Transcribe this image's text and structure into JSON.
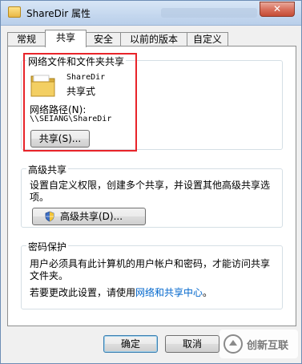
{
  "window": {
    "title": "ShareDir 属性",
    "close_glyph": "✕"
  },
  "tabs": [
    "常规",
    "共享",
    "安全",
    "以前的版本",
    "自定义"
  ],
  "sharing": {
    "group_label": "网络文件和文件夹共享",
    "folder_name": "ShareDir",
    "folder_state": "共享式",
    "network_path_label": "网络路径(N):",
    "network_path": "\\\\SEIANG\\ShareDir",
    "share_button": "共享(S)..."
  },
  "advanced": {
    "group_label": "高级共享",
    "description": "设置自定义权限，创建多个共享，并设置其他高级共享选项。",
    "description_line1": "设置自定义权限，创建多个共享，并设置其他高级共享选",
    "description_line2": "项。",
    "button": "高级共享(D)..."
  },
  "password": {
    "group_label": "密码保护",
    "line1": "用户必须具有此计算机的用户帐户和密码，才能访问共享",
    "line2": "文件夹。",
    "change_prefix": "若要更改此设置，请使用",
    "link": "网络和共享中心",
    "change_suffix": "。"
  },
  "footer": {
    "ok": "确定",
    "cancel": "取消"
  },
  "watermark": {
    "text": "创新互联"
  },
  "colors": {
    "highlight_frame": "#e8242a",
    "link": "#0066cc"
  }
}
